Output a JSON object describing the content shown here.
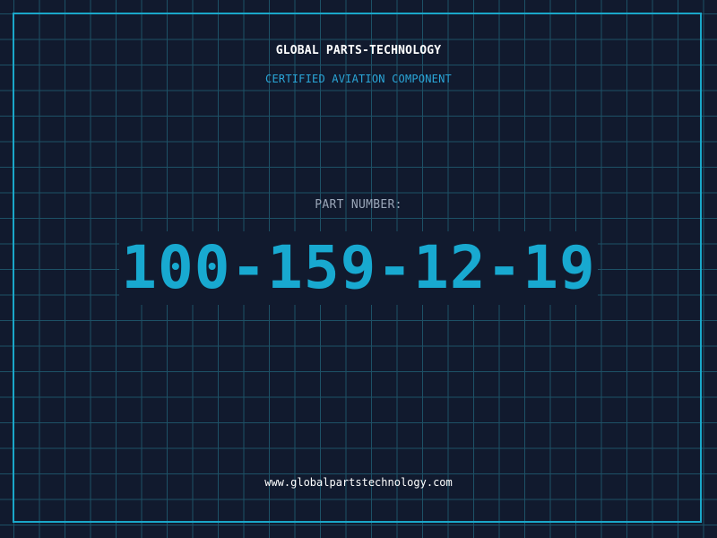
{
  "header": {
    "brand": "GLOBAL PARTS-TECHNOLOGY",
    "tagline": "CERTIFIED AVIATION COMPONENT"
  },
  "part": {
    "label": "PART NUMBER:",
    "number": "100-159-12-19"
  },
  "footer": {
    "website": "www.globalpartstechnology.com"
  },
  "colors": {
    "background": "#111a2e",
    "grid": "#1d5166",
    "accent": "#18a9d0",
    "label": "#9aa6b8",
    "text": "#ffffff"
  }
}
